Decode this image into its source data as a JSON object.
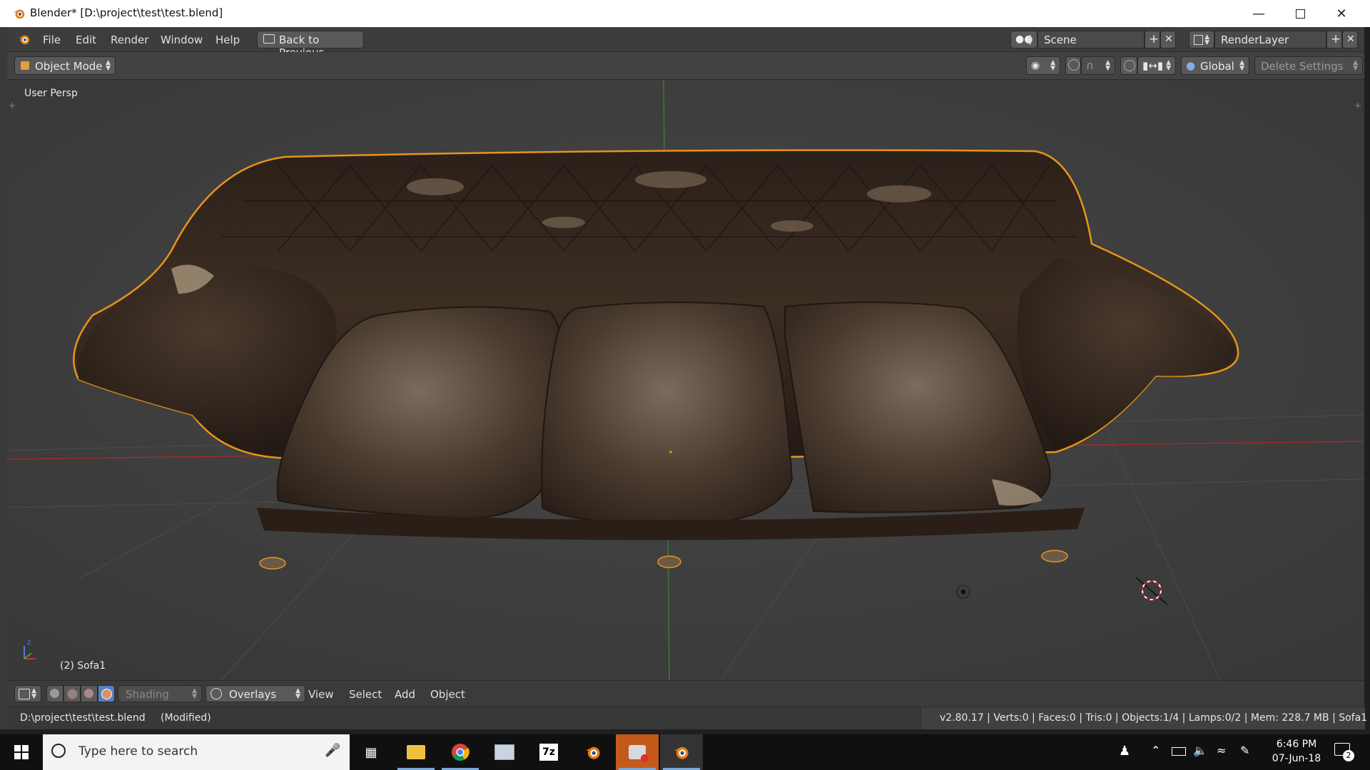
{
  "window": {
    "title": "Blender* [D:\\project\\test\\test.blend]"
  },
  "menubar": {
    "items": [
      "File",
      "Edit",
      "Render",
      "Window",
      "Help"
    ],
    "back_button": "Back to Previous",
    "scene": "Scene",
    "render_layer": "RenderLayer"
  },
  "header": {
    "mode": "Object Mode",
    "orientation": "Global",
    "delete_settings": "Delete Settings"
  },
  "viewport": {
    "view_label": "User Persp",
    "object_label": "(2) Sofa1"
  },
  "footer": {
    "shading": "Shading",
    "overlays": "Overlays",
    "menus": [
      "View",
      "Select",
      "Add",
      "Object"
    ]
  },
  "status": {
    "file": "D:\\project\\test\\test.blend",
    "modified": "(Modified)",
    "stats": "v2.80.17 | Verts:0 | Faces:0 | Tris:0 | Objects:1/4 | Lamps:0/2 | Mem: 228.7 MB | Sofa1"
  },
  "taskbar": {
    "search_placeholder": "Type here to search",
    "time": "6:46 PM",
    "date": "07-Jun-18",
    "notification_count": "2"
  },
  "colors": {
    "selection_outline": "#e8941a",
    "x_axis": "#a02a2a",
    "y_axis": "#3d7a2e"
  }
}
